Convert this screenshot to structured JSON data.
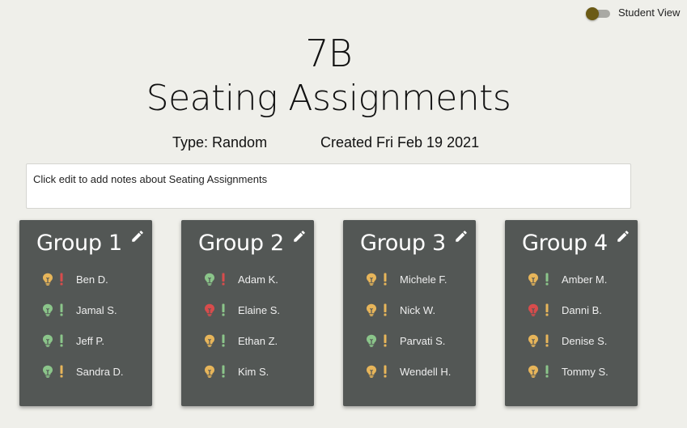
{
  "toggle": {
    "label": "Student View"
  },
  "header": {
    "class_name": "7B",
    "title": "Seating Assignments",
    "type": "Type: Random",
    "created": "Created Fri Feb 19 2021"
  },
  "notes": {
    "text": "Click edit to add notes about Seating Assignments"
  },
  "colors": {
    "background": "#efefea",
    "card": "#535755",
    "green": "#8bc58a",
    "orange": "#e7b55a",
    "red": "#d84c4c",
    "toggle_knob": "#6b5a15"
  },
  "groups": [
    {
      "title": "Group 1",
      "students": [
        {
          "name": "Ben D.",
          "bulb": "orange",
          "alert": "red"
        },
        {
          "name": "Jamal S.",
          "bulb": "green",
          "alert": "green"
        },
        {
          "name": "Jeff P.",
          "bulb": "green",
          "alert": "green"
        },
        {
          "name": "Sandra D.",
          "bulb": "green",
          "alert": "orange"
        }
      ]
    },
    {
      "title": "Group 2",
      "students": [
        {
          "name": "Adam K.",
          "bulb": "green",
          "alert": "red"
        },
        {
          "name": "Elaine S.",
          "bulb": "red",
          "alert": "green"
        },
        {
          "name": "Ethan Z.",
          "bulb": "orange",
          "alert": "green"
        },
        {
          "name": "Kim S.",
          "bulb": "orange",
          "alert": "green"
        }
      ]
    },
    {
      "title": "Group 3",
      "students": [
        {
          "name": "Michele F.",
          "bulb": "orange",
          "alert": "orange"
        },
        {
          "name": "Nick W.",
          "bulb": "orange",
          "alert": "orange"
        },
        {
          "name": "Parvati S.",
          "bulb": "green",
          "alert": "orange"
        },
        {
          "name": "Wendell H.",
          "bulb": "orange",
          "alert": "orange"
        }
      ]
    },
    {
      "title": "Group 4",
      "students": [
        {
          "name": "Amber M.",
          "bulb": "orange",
          "alert": "green"
        },
        {
          "name": "Danni B.",
          "bulb": "red",
          "alert": "orange"
        },
        {
          "name": "Denise S.",
          "bulb": "orange",
          "alert": "orange"
        },
        {
          "name": "Tommy S.",
          "bulb": "orange",
          "alert": "green"
        }
      ]
    }
  ]
}
